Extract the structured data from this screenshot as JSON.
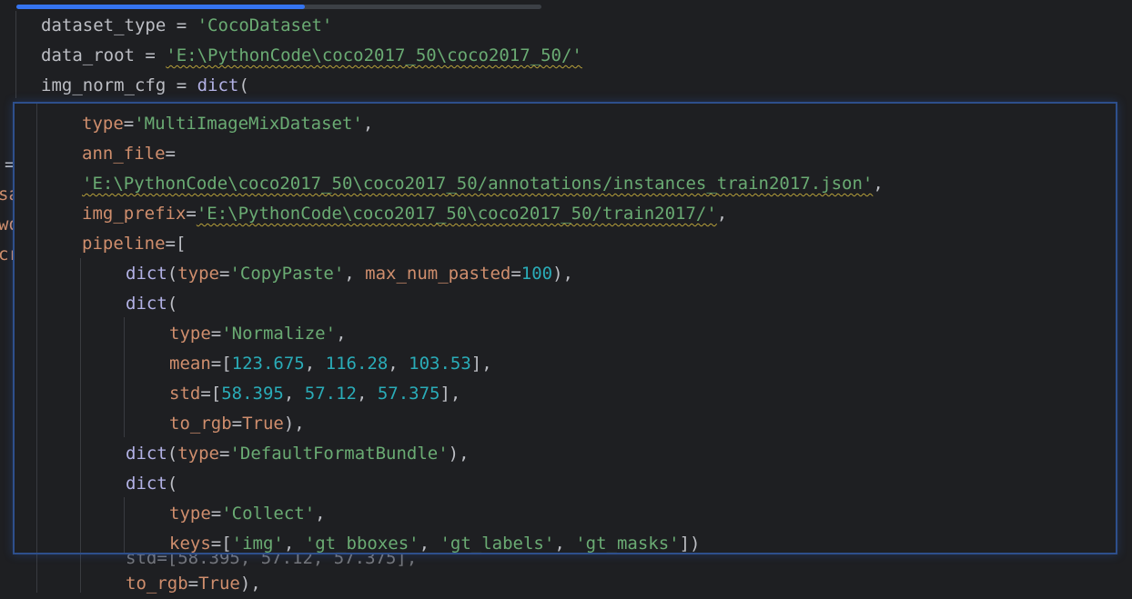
{
  "progress": {
    "fraction": 0.55
  },
  "editor": {
    "bg_lines": [
      {
        "var": "dataset_type",
        "eq": " = ",
        "str": "'CocoDataset'"
      },
      {
        "var": "data_root",
        "eq": " = ",
        "str": "'E:\\PythonCode\\coco2017_50\\coco2017_50/'"
      },
      {
        "var": "img_norm_cfg",
        "eq": " = ",
        "func": "dict",
        "paren": "("
      }
    ],
    "ghost_fragments": [
      "=",
      "sa",
      "wo",
      "cr",
      "std=[58.395, 57.12, 57.375],"
    ],
    "bottom_line": {
      "kw": "to_rgb",
      "eq": "=",
      "val": "True",
      "tail": "),"
    }
  },
  "popup": {
    "l1": {
      "kw": "type",
      "eq": "=",
      "str": "'MultiImageMixDataset'",
      "tail": ","
    },
    "l2": {
      "kw": "ann_file",
      "eq": "="
    },
    "l3": {
      "str": "'E:\\PythonCode\\coco2017_50\\coco2017_50/annotations/instances_train2017.json'",
      "tail": ","
    },
    "l4": {
      "kw": "img_prefix",
      "eq": "=",
      "str": "'E:\\PythonCode\\coco2017_50\\coco2017_50/train2017/'",
      "tail": ","
    },
    "l5": {
      "kw": "pipeline",
      "eq": "=",
      "tail": "["
    },
    "l6": {
      "func": "dict",
      "open": "(",
      "kw": "type",
      "eq": "=",
      "str": "'CopyPaste'",
      "sep": ", ",
      "kw2": "max_num_pasted",
      "eq2": "=",
      "num": "100",
      "tail": "),"
    },
    "l7": {
      "func": "dict",
      "open": "("
    },
    "l8": {
      "kw": "type",
      "eq": "=",
      "str": "'Normalize'",
      "tail": ","
    },
    "l9": {
      "kw": "mean",
      "eq": "=[",
      "n1": "123.675",
      "n2": "116.28",
      "n3": "103.53",
      "sep": ", ",
      "tail": "],"
    },
    "l10": {
      "kw": "std",
      "eq": "=[",
      "n1": "58.395",
      "n2": "57.12",
      "n3": "57.375",
      "sep": ", ",
      "tail": "],"
    },
    "l11": {
      "kw": "to_rgb",
      "eq": "=",
      "val": "True",
      "tail": "),"
    },
    "l12": {
      "func": "dict",
      "open": "(",
      "kw": "type",
      "eq": "=",
      "str": "'DefaultFormatBundle'",
      "tail": "),"
    },
    "l13": {
      "func": "dict",
      "open": "("
    },
    "l14": {
      "kw": "type",
      "eq": "=",
      "str": "'Collect'",
      "tail": ","
    },
    "l15": {
      "kw": "keys",
      "eq": "=[",
      "s1": "'img'",
      "s2": "'gt_bboxes'",
      "s3": "'gt_labels'",
      "s4": "'gt_masks'",
      "sep": ", ",
      "tail": "])"
    }
  },
  "colors": {
    "background": "#1e1f22",
    "keyword_arg": "#cf8e6d",
    "string": "#6aab73",
    "number": "#2aacb8",
    "builtin": "#b3b2e6",
    "text": "#bcbec4",
    "progress": "#3574f0",
    "popup_border": "#2e4f8c"
  }
}
